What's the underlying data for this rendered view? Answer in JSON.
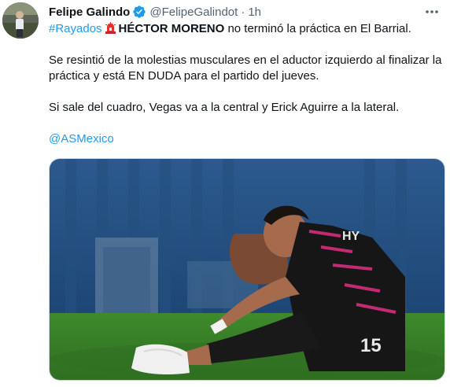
{
  "tweet": {
    "author_name": "Felipe Galindo",
    "handle": "@FelipeGalindot",
    "separator": "·",
    "time": "1h",
    "more_label": "···",
    "hashtag": "#Rayados",
    "emoji_name": "police-light-emoji",
    "headline_bold": "HÉCTOR MORENO",
    "headline_rest": " no terminó la práctica en El Barrial.",
    "paragraph2": "Se resintió de la molestias musculares en el aductor izquierdo al finalizar la práctica y está EN DUDA para el partido del jueves.",
    "paragraph3": "Si sale del cuadro, Vegas va a la central y Erick Aguirre a la lateral.",
    "mention": "@ASMexico",
    "image_name": "HY",
    "image_number": "15"
  },
  "colors": {
    "link": "#1d9bf0",
    "verified": "#1d9bf0",
    "text": "#0f1419",
    "secondary": "#536471"
  }
}
